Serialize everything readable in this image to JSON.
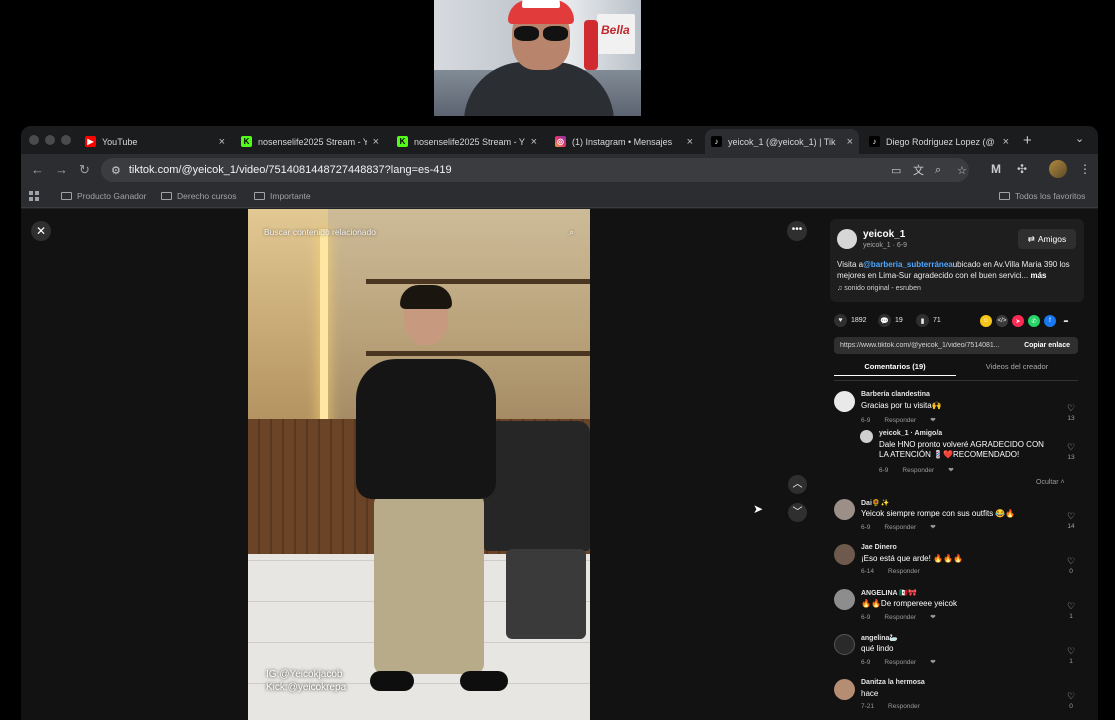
{
  "browser": {
    "tabs": [
      {
        "title": "YouTube",
        "favicon": "youtube-icon",
        "color": "#ff0000"
      },
      {
        "title": "nosenselife2025 Stream - Y",
        "favicon": "kick-icon",
        "color": "#53fc18"
      },
      {
        "title": "nosenselife2025 Stream - Y",
        "favicon": "kick-icon",
        "color": "#53fc18"
      },
      {
        "title": "(1) Instagram • Mensajes",
        "favicon": "instagram-icon",
        "color": "#e1306c"
      },
      {
        "title": "yeicok_1 (@yeicok_1) | Tik",
        "favicon": "tiktok-icon",
        "color": "#000000"
      },
      {
        "title": "Diego Rodriguez Lopez (@",
        "favicon": "tiktok-icon",
        "color": "#000000"
      }
    ],
    "url": "tiktok.com/@yeicok_1/video/7514081448727448837?lang=es-419",
    "bookmarks": [
      "Producto Ganador",
      "Derecho cursos",
      "Importante"
    ],
    "bookmarks_right": "Todos los favoritos"
  },
  "video": {
    "search_placeholder": "Buscar contenido relacionado",
    "overlay_line1": "IG:@Yeicokjacob",
    "overlay_line2": "Kick:@yeicokrepa"
  },
  "post": {
    "author": "yeicok_1",
    "author_sub": "yeicok_1 · 6-9",
    "friends_label": "Amigos",
    "desc_prefix": "Visita a",
    "desc_mention": "@barberia_subterránea",
    "desc_rest": "ubicado en Av.Villa Maria 390 los mejores en Lima-Sur agradecido con el buen servici...",
    "desc_more": "más",
    "sound": "sonido original - esruben",
    "likes": "1892",
    "comments_count": "19",
    "saves": "71",
    "link": "https://www.tiktok.com/@yeicok_1/video/7514081...",
    "copy_label": "Copiar enlace",
    "tab_comments": "Comentarios (19)",
    "tab_creator": "Videos del creador",
    "hide_label": "Ocultar"
  },
  "comments": [
    {
      "name": "Barbería clandestina",
      "text": "Gracias por tu visita🙌",
      "date": "6-9",
      "reply": "Responder",
      "likes": "13"
    },
    {
      "name": "yeicok_1 · Amigo/a",
      "text": "Dale HNO pronto volveré AGRADECIDO CON LA ATENCIÓN 💈❤️RECOMENDADO!",
      "date": "6-9",
      "reply": "Responder",
      "likes": "13"
    },
    {
      "name": "Dai🌻✨",
      "text": "Yeicok siempre rompe con sus outfits 😂🔥",
      "date": "6-9",
      "reply": "Responder",
      "likes": "14"
    },
    {
      "name": "Jae Dinero",
      "text": "¡Eso está que arde! 🔥🔥🔥",
      "date": "6-14",
      "reply": "Responder",
      "likes": "0"
    },
    {
      "name": "ANGELINA 🇲🇽🎀",
      "text": "🔥🔥De rompereee yeicok",
      "date": "6-9",
      "reply": "Responder",
      "likes": "1"
    },
    {
      "name": "angelina🦢",
      "text": "qué lindo",
      "date": "6-9",
      "reply": "Responder",
      "likes": "1"
    },
    {
      "name": "Danitza la hermosa",
      "text": "hace",
      "date": "7-21",
      "reply": "Responder",
      "likes": "0"
    }
  ]
}
